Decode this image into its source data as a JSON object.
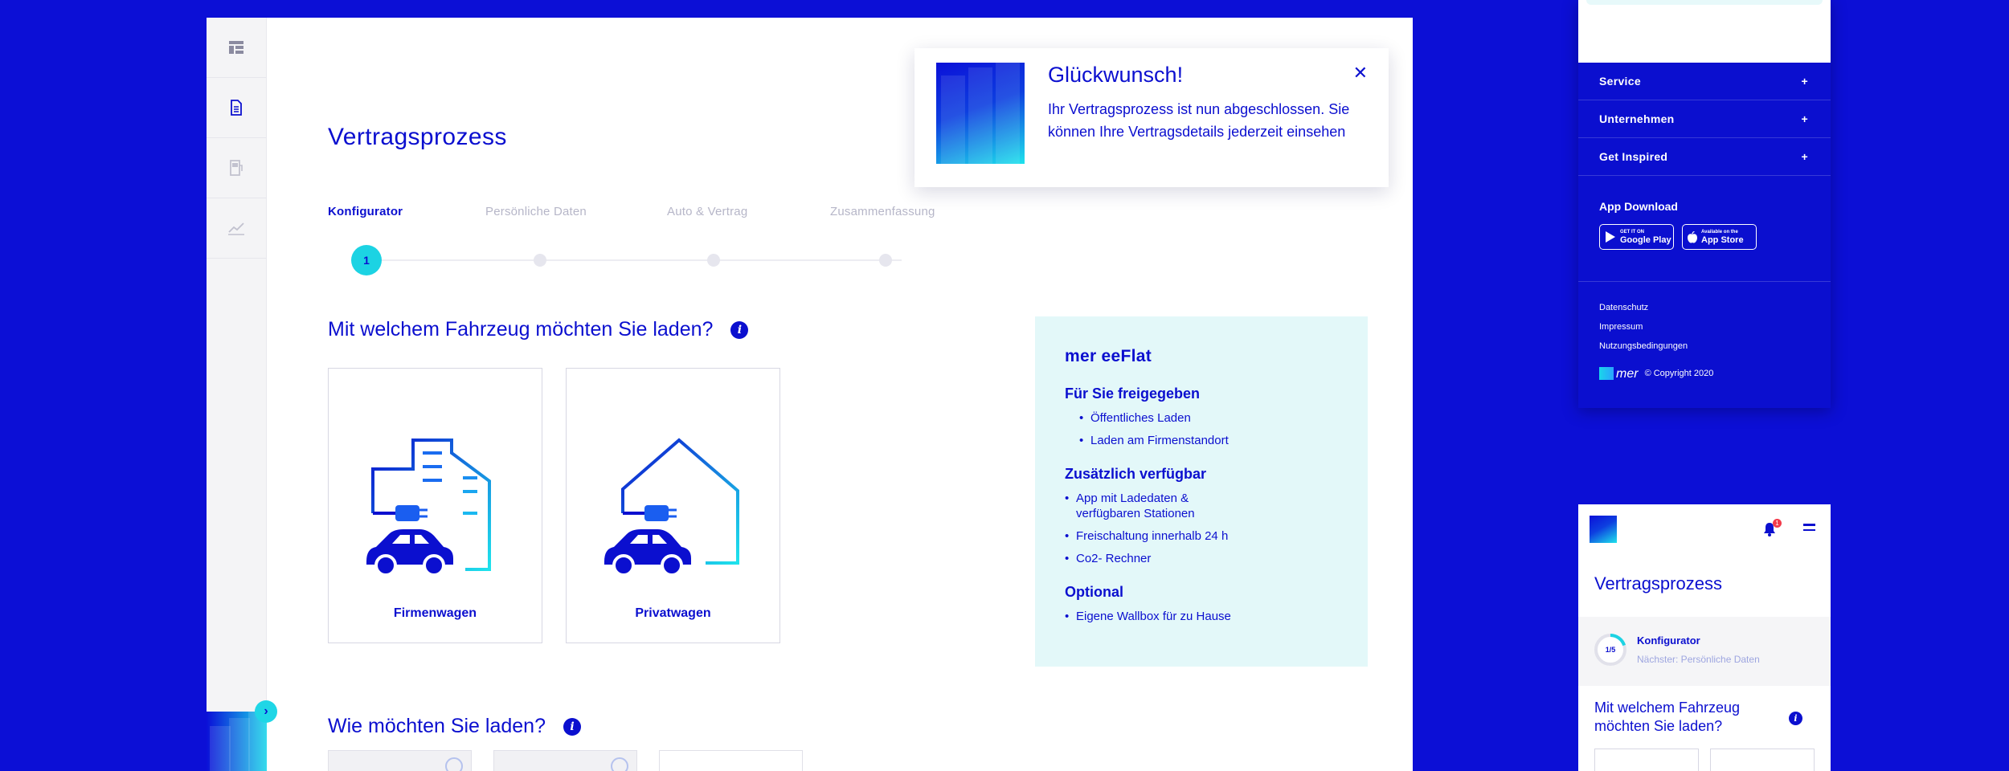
{
  "desktop": {
    "rail": {
      "items": [
        {
          "icon": "table-icon",
          "active": false
        },
        {
          "icon": "document-icon",
          "active": true
        },
        {
          "icon": "charging-station-icon",
          "active": false
        },
        {
          "icon": "chart-line-icon",
          "active": false
        }
      ],
      "toggle_icon": "chevron-right-icon"
    },
    "page_title": "Vertragsprozess",
    "stepper": {
      "steps": [
        {
          "label": "Konfigurator",
          "number": "1",
          "active": true
        },
        {
          "label": "Persönliche Daten",
          "active": false
        },
        {
          "label": "Auto & Vertrag",
          "active": false
        },
        {
          "label": "Zusammenfassung",
          "active": false
        }
      ]
    },
    "vehicle_question": "Mit welchem Fahrzeug möchten Sie laden?",
    "vehicle_options": [
      {
        "label": "Firmenwagen",
        "icon": "company-car-icon"
      },
      {
        "label": "Privatwagen",
        "icon": "private-car-icon"
      }
    ],
    "charge_question": "Wie möchten Sie laden?",
    "eeflat": {
      "title": "mer eeFlat",
      "sections": [
        {
          "heading": "Für Sie freigegeben",
          "items": [
            "Öffentliches Laden",
            "Laden am Firmenstandort"
          ]
        },
        {
          "heading": "Zusätzlich verfügbar",
          "items": [
            "App mit Ladedaten & verfügbaren Stationen",
            "Freischaltung innerhalb 24 h",
            "Co2- Rechner"
          ]
        },
        {
          "heading": "Optional",
          "items": [
            "Eigene Wallbox für zu Hause"
          ]
        }
      ]
    },
    "toast": {
      "title": "Glückwunsch!",
      "message": "Ihr Vertragsprozess ist nun abgeschlossen. Sie können Ihre Vertragsdetails jederzeit einsehen",
      "close": "✕"
    }
  },
  "mobile_menu": {
    "items": [
      {
        "label": "Service",
        "toggle": "+"
      },
      {
        "label": "Unternehmen",
        "toggle": "+"
      },
      {
        "label": "Get Inspired",
        "toggle": "+"
      }
    ],
    "app_download": "App Download",
    "badges": [
      {
        "small": "GET IT ON",
        "big": "Google Play",
        "icon": "play-store-icon"
      },
      {
        "small": "Available on the",
        "big": "App Store",
        "icon": "apple-icon"
      }
    ],
    "legal_links": [
      "Datenschutz",
      "Impressum",
      "Nutzungsbedingungen"
    ],
    "logo_text": "mer",
    "copyright": "© Copyright 2020"
  },
  "mobile": {
    "notification_count": "1",
    "title": "Vertragsprozess",
    "step_progress": "1/5",
    "step_progress_fraction": 0.2,
    "step_name": "Konfigurator",
    "next_step": "Nächster: Persönliche Daten",
    "question": "Mit welchem Fahrzeug möchten Sie laden?"
  },
  "colors": {
    "background": "#0c0fd6",
    "primary": "#0b0fcf",
    "accent": "#1cd3e3",
    "panel": "#e3f8f9"
  }
}
